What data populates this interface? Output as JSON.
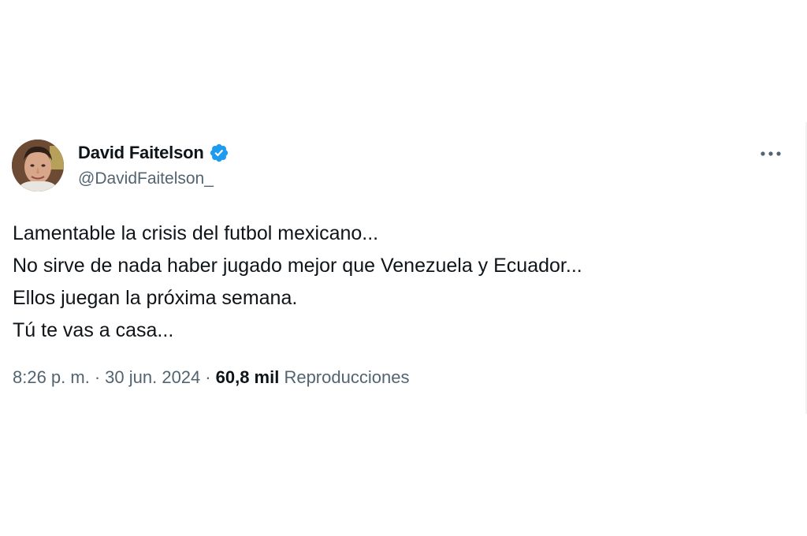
{
  "author": {
    "display_name": "David Faitelson",
    "handle": "@DavidFaitelson_",
    "verified": true,
    "avatar_icon": "profile-photo"
  },
  "tweet": {
    "lines": [
      "Lamentable la crisis del futbol mexicano...",
      "No sirve de nada haber jugado mejor que Venezuela y Ecuador...",
      "Ellos juegan la próxima semana.",
      "Tú te vas a casa..."
    ]
  },
  "meta": {
    "time": "8:26 p. m.",
    "separator": "·",
    "date": "30 jun. 2024",
    "views_count": "60,8 mil",
    "views_label": "Reproducciones"
  },
  "icons": {
    "verified": "verified-badge-icon",
    "more": "more-options-icon"
  },
  "colors": {
    "text_primary": "#0f1419",
    "text_secondary": "#536471",
    "verified_blue": "#1d9bf0"
  }
}
